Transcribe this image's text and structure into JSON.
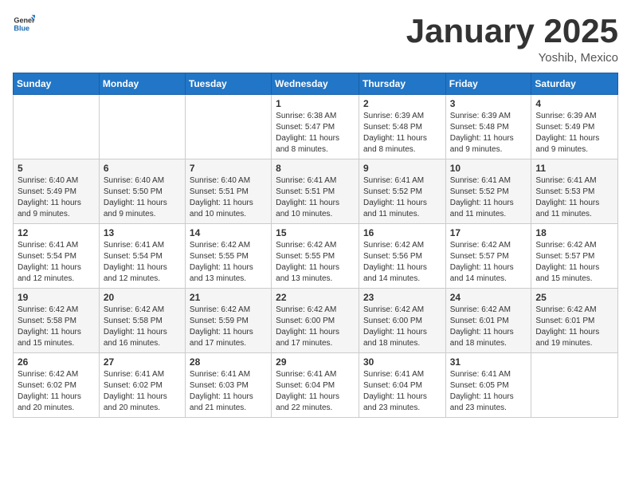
{
  "header": {
    "logo_general": "General",
    "logo_blue": "Blue",
    "title": "January 2025",
    "subtitle": "Yoshib, Mexico"
  },
  "weekdays": [
    "Sunday",
    "Monday",
    "Tuesday",
    "Wednesday",
    "Thursday",
    "Friday",
    "Saturday"
  ],
  "weeks": [
    [
      {
        "day": "",
        "sunrise": "",
        "sunset": "",
        "daylight": ""
      },
      {
        "day": "",
        "sunrise": "",
        "sunset": "",
        "daylight": ""
      },
      {
        "day": "",
        "sunrise": "",
        "sunset": "",
        "daylight": ""
      },
      {
        "day": "1",
        "sunrise": "Sunrise: 6:38 AM",
        "sunset": "Sunset: 5:47 PM",
        "daylight": "Daylight: 11 hours and 8 minutes."
      },
      {
        "day": "2",
        "sunrise": "Sunrise: 6:39 AM",
        "sunset": "Sunset: 5:48 PM",
        "daylight": "Daylight: 11 hours and 8 minutes."
      },
      {
        "day": "3",
        "sunrise": "Sunrise: 6:39 AM",
        "sunset": "Sunset: 5:48 PM",
        "daylight": "Daylight: 11 hours and 9 minutes."
      },
      {
        "day": "4",
        "sunrise": "Sunrise: 6:39 AM",
        "sunset": "Sunset: 5:49 PM",
        "daylight": "Daylight: 11 hours and 9 minutes."
      }
    ],
    [
      {
        "day": "5",
        "sunrise": "Sunrise: 6:40 AM",
        "sunset": "Sunset: 5:49 PM",
        "daylight": "Daylight: 11 hours and 9 minutes."
      },
      {
        "day": "6",
        "sunrise": "Sunrise: 6:40 AM",
        "sunset": "Sunset: 5:50 PM",
        "daylight": "Daylight: 11 hours and 9 minutes."
      },
      {
        "day": "7",
        "sunrise": "Sunrise: 6:40 AM",
        "sunset": "Sunset: 5:51 PM",
        "daylight": "Daylight: 11 hours and 10 minutes."
      },
      {
        "day": "8",
        "sunrise": "Sunrise: 6:41 AM",
        "sunset": "Sunset: 5:51 PM",
        "daylight": "Daylight: 11 hours and 10 minutes."
      },
      {
        "day": "9",
        "sunrise": "Sunrise: 6:41 AM",
        "sunset": "Sunset: 5:52 PM",
        "daylight": "Daylight: 11 hours and 11 minutes."
      },
      {
        "day": "10",
        "sunrise": "Sunrise: 6:41 AM",
        "sunset": "Sunset: 5:52 PM",
        "daylight": "Daylight: 11 hours and 11 minutes."
      },
      {
        "day": "11",
        "sunrise": "Sunrise: 6:41 AM",
        "sunset": "Sunset: 5:53 PM",
        "daylight": "Daylight: 11 hours and 11 minutes."
      }
    ],
    [
      {
        "day": "12",
        "sunrise": "Sunrise: 6:41 AM",
        "sunset": "Sunset: 5:54 PM",
        "daylight": "Daylight: 11 hours and 12 minutes."
      },
      {
        "day": "13",
        "sunrise": "Sunrise: 6:41 AM",
        "sunset": "Sunset: 5:54 PM",
        "daylight": "Daylight: 11 hours and 12 minutes."
      },
      {
        "day": "14",
        "sunrise": "Sunrise: 6:42 AM",
        "sunset": "Sunset: 5:55 PM",
        "daylight": "Daylight: 11 hours and 13 minutes."
      },
      {
        "day": "15",
        "sunrise": "Sunrise: 6:42 AM",
        "sunset": "Sunset: 5:55 PM",
        "daylight": "Daylight: 11 hours and 13 minutes."
      },
      {
        "day": "16",
        "sunrise": "Sunrise: 6:42 AM",
        "sunset": "Sunset: 5:56 PM",
        "daylight": "Daylight: 11 hours and 14 minutes."
      },
      {
        "day": "17",
        "sunrise": "Sunrise: 6:42 AM",
        "sunset": "Sunset: 5:57 PM",
        "daylight": "Daylight: 11 hours and 14 minutes."
      },
      {
        "day": "18",
        "sunrise": "Sunrise: 6:42 AM",
        "sunset": "Sunset: 5:57 PM",
        "daylight": "Daylight: 11 hours and 15 minutes."
      }
    ],
    [
      {
        "day": "19",
        "sunrise": "Sunrise: 6:42 AM",
        "sunset": "Sunset: 5:58 PM",
        "daylight": "Daylight: 11 hours and 15 minutes."
      },
      {
        "day": "20",
        "sunrise": "Sunrise: 6:42 AM",
        "sunset": "Sunset: 5:58 PM",
        "daylight": "Daylight: 11 hours and 16 minutes."
      },
      {
        "day": "21",
        "sunrise": "Sunrise: 6:42 AM",
        "sunset": "Sunset: 5:59 PM",
        "daylight": "Daylight: 11 hours and 17 minutes."
      },
      {
        "day": "22",
        "sunrise": "Sunrise: 6:42 AM",
        "sunset": "Sunset: 6:00 PM",
        "daylight": "Daylight: 11 hours and 17 minutes."
      },
      {
        "day": "23",
        "sunrise": "Sunrise: 6:42 AM",
        "sunset": "Sunset: 6:00 PM",
        "daylight": "Daylight: 11 hours and 18 minutes."
      },
      {
        "day": "24",
        "sunrise": "Sunrise: 6:42 AM",
        "sunset": "Sunset: 6:01 PM",
        "daylight": "Daylight: 11 hours and 18 minutes."
      },
      {
        "day": "25",
        "sunrise": "Sunrise: 6:42 AM",
        "sunset": "Sunset: 6:01 PM",
        "daylight": "Daylight: 11 hours and 19 minutes."
      }
    ],
    [
      {
        "day": "26",
        "sunrise": "Sunrise: 6:42 AM",
        "sunset": "Sunset: 6:02 PM",
        "daylight": "Daylight: 11 hours and 20 minutes."
      },
      {
        "day": "27",
        "sunrise": "Sunrise: 6:41 AM",
        "sunset": "Sunset: 6:02 PM",
        "daylight": "Daylight: 11 hours and 20 minutes."
      },
      {
        "day": "28",
        "sunrise": "Sunrise: 6:41 AM",
        "sunset": "Sunset: 6:03 PM",
        "daylight": "Daylight: 11 hours and 21 minutes."
      },
      {
        "day": "29",
        "sunrise": "Sunrise: 6:41 AM",
        "sunset": "Sunset: 6:04 PM",
        "daylight": "Daylight: 11 hours and 22 minutes."
      },
      {
        "day": "30",
        "sunrise": "Sunrise: 6:41 AM",
        "sunset": "Sunset: 6:04 PM",
        "daylight": "Daylight: 11 hours and 23 minutes."
      },
      {
        "day": "31",
        "sunrise": "Sunrise: 6:41 AM",
        "sunset": "Sunset: 6:05 PM",
        "daylight": "Daylight: 11 hours and 23 minutes."
      },
      {
        "day": "",
        "sunrise": "",
        "sunset": "",
        "daylight": ""
      }
    ]
  ]
}
